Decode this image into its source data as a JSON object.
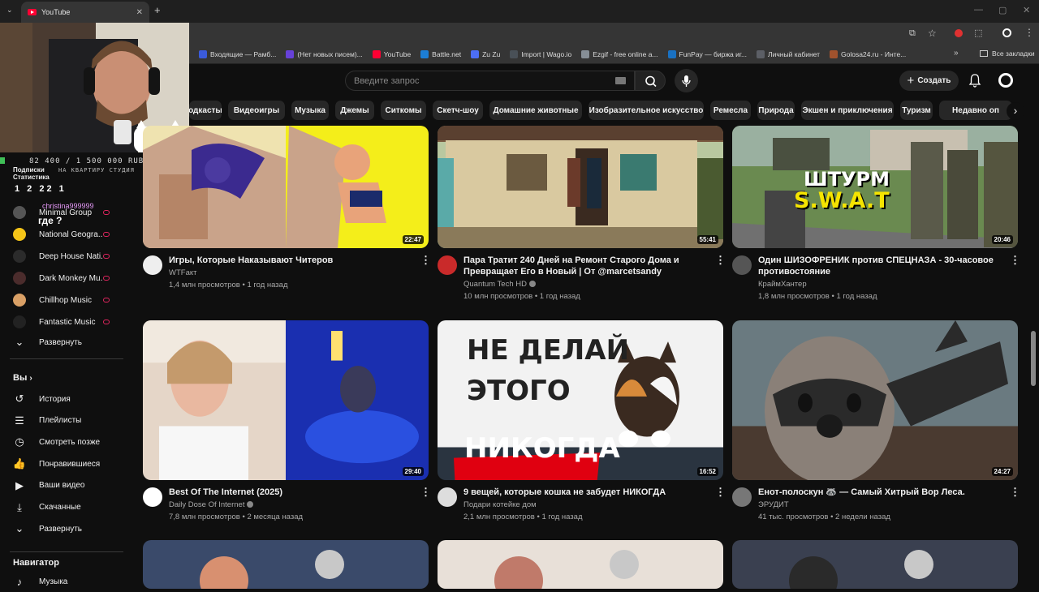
{
  "browser": {
    "tab_title": "YouTube",
    "bookmarks": [
      {
        "label": "Входящие — Рамб...",
        "color": "#3b5bdb"
      },
      {
        "label": "(Нет новых писем)...",
        "color": "#6741d9"
      },
      {
        "label": "YouTube",
        "color": "#ff0033"
      },
      {
        "label": "Battle.net",
        "color": "#1c7ed6"
      },
      {
        "label": "Zu Zu",
        "color": "#4c6ef5"
      },
      {
        "label": "Import | Wago.io",
        "color": "#495057"
      },
      {
        "label": "Ezgif - free online a...",
        "color": "#868e96"
      },
      {
        "label": "FunPay — биржа иг...",
        "color": "#1971c2"
      },
      {
        "label": "Личный кабинет",
        "color": "#5c5f66"
      },
      {
        "label": "Golosa24.ru - Инте...",
        "color": "#a0522d"
      }
    ],
    "all_bookmarks": "Все закладки"
  },
  "header": {
    "search_placeholder": "Введите запрос",
    "create_label": "Создать"
  },
  "chips": [
    "одкасты",
    "Видеоигры",
    "Музыка",
    "Джемы",
    "Ситкомы",
    "Скетч-шоу",
    "Домашние животные",
    "Изобразительное искусство",
    "Ремесла",
    "Природа",
    "Экшен и приключения",
    "Туризм",
    "Недавно оп"
  ],
  "sidebar": {
    "subscriptions": [
      {
        "label": "Minimal Group",
        "live": true
      },
      {
        "label": "National Geogra...",
        "live": true
      },
      {
        "label": "Deep House Nati...",
        "live": true
      },
      {
        "label": "Dark Monkey Mu...",
        "live": true
      },
      {
        "label": "Chillhop Music",
        "live": true
      },
      {
        "label": "Fantastic Music",
        "live": true
      }
    ],
    "expand1": "Развернуть",
    "you_heading": "Вы",
    "you_items": [
      "История",
      "Плейлисты",
      "Смотреть позже",
      "Понравившиеся",
      "Ваши видео",
      "Скачанные",
      "Развернуть"
    ],
    "nav_heading": "Навигатор",
    "nav_first": "Музыка"
  },
  "overlay": {
    "goal": "82 400 / 1 500 000 RUB",
    "goal_sub": "НА КВАРТИРУ СТУДИЯ",
    "podpis": "Подписки",
    "stats": "Статистика",
    "counts": "1  2  22  1",
    "user": "christina999999",
    "chat": "где ?"
  },
  "videos": [
    {
      "title": "Игры, Которые Наказывают Читеров",
      "channel": "WTFакт",
      "meta": "1,4 млн просмотров • 1 год назад",
      "duration": "22:47",
      "verified": false
    },
    {
      "title": "Пара Тратит 240 Дней на Ремонт Старого Дома и Превращает Его в Новый | От @marcetsandy",
      "channel": "Quantum Tech HD",
      "meta": "10 млн просмотров • 1 год назад",
      "duration": "55:41",
      "verified": true
    },
    {
      "title": "Один ШИЗОФРЕНИК против СПЕЦНАЗА - 30-часовое противостояние",
      "channel": "КраймХантер",
      "meta": "1,8 млн просмотров • 1 год назад",
      "duration": "20:46",
      "verified": false
    },
    {
      "title": "Best Of The Internet (2025)",
      "channel": "Daily Dose Of Internet",
      "meta": "7,8 млн просмотров • 2 месяца назад",
      "duration": "29:40",
      "verified": true
    },
    {
      "title": "9 вещей, которые кошка не забудет НИКОГДА",
      "channel": "Подари котейке дом",
      "meta": "2,1 млн просмотров • 1 год назад",
      "duration": "16:52",
      "verified": false
    },
    {
      "title": "Енот-полоскун 🦝 — Самый Хитрый Вор Леса.",
      "channel": "ЭРУДИТ",
      "meta": "41 тыс. просмотров • 2 недели назад",
      "duration": "24:27",
      "verified": false
    }
  ],
  "thumb_text": {
    "swat1": "ШТУРМ",
    "swat2": "S.W.A.T",
    "cat1": "НЕ ДЕЛАЙ",
    "cat2": "ЭТОГО",
    "cat3": "НИКОГДА"
  }
}
